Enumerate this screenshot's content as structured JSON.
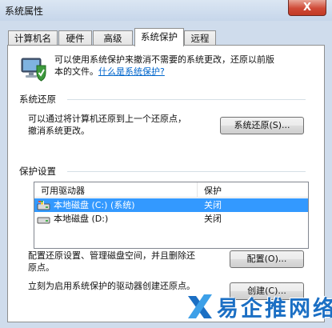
{
  "window": {
    "title": "系统属性",
    "close_label": "X"
  },
  "tabs": [
    {
      "label": "计算机名"
    },
    {
      "label": "硬件"
    },
    {
      "label": "高级"
    },
    {
      "label": "系统保护",
      "active": true
    },
    {
      "label": "远程"
    }
  ],
  "intro": {
    "line1": "可以使用系统保护来撤消不需要的系统更改，还原以前版",
    "line2_prefix": "本的文件。",
    "link": "什么是系统保护?",
    "icon": "computer-shield-icon"
  },
  "restore": {
    "heading": "系统还原",
    "text_line1": "可以通过将计算机还原到上一个还原点，",
    "text_line2": "撤消系统更改。",
    "button": "系统还原(S)..."
  },
  "protection": {
    "heading": "保护设置",
    "columns": [
      "可用驱动器",
      "保护"
    ],
    "rows": [
      {
        "drive": "本地磁盘 (C:) (系统)",
        "status": "关闭",
        "icon": "system-drive-icon",
        "selected": true
      },
      {
        "drive": "本地磁盘 (D:)",
        "status": "关闭",
        "icon": "hard-drive-icon",
        "selected": false
      }
    ],
    "configure_line1": "配置还原设置、管理磁盘空间，并且删除还",
    "configure_line2": "原点。",
    "configure_button": "配置(O)...",
    "create_text": "立刻为启用系统保护的驱动器创建还原点。",
    "create_button": "创建(C)..."
  },
  "watermark": {
    "text": "易企推网络"
  },
  "colors": {
    "selection": "#3399ff",
    "link": "#0066cc",
    "title_bar": "#c6d6ea"
  }
}
